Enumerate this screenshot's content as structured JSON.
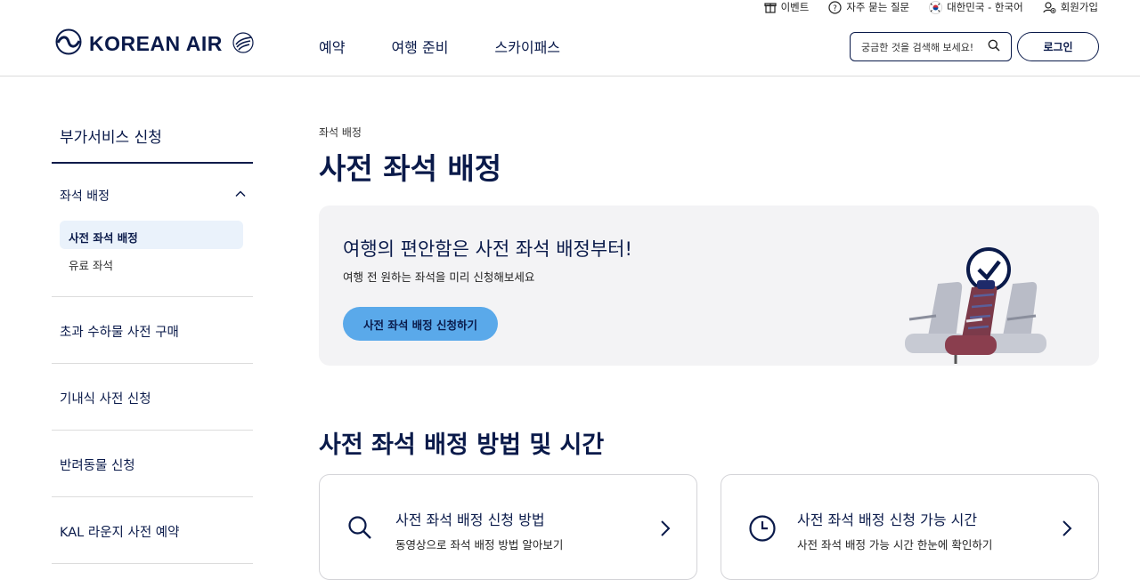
{
  "utility": {
    "items": [
      {
        "label": "이벤트",
        "icon": "gift-icon"
      },
      {
        "label": "자주 묻는 질문",
        "icon": "question-circle-icon"
      },
      {
        "label": "대한민국 - 한국어",
        "icon": "korea-flag-icon"
      },
      {
        "label": "회원가입",
        "icon": "user-add-icon"
      }
    ]
  },
  "header": {
    "logo_text": "KOREAN AIR",
    "nav": [
      "예약",
      "여행 준비",
      "스카이패스"
    ],
    "search_placeholder": "궁금한 것을 검색해 보세요!",
    "login_label": "로그인"
  },
  "sidebar": {
    "title": "부가서비스 신청",
    "group": {
      "label": "좌석 배정",
      "children": [
        "사전 좌석 배정",
        "유료 좌석"
      ]
    },
    "links": [
      "초과 수하물 사전 구매",
      "기내식 사전 신청",
      "반려동물 신청",
      "KAL 라운지 사전 예약"
    ]
  },
  "main": {
    "breadcrumb": "좌석 배정",
    "title": "사전 좌석 배정",
    "banner": {
      "headline": "여행의 편안함은 사전 좌석 배정부터!",
      "subtext": "여행 전 원하는 좌석을 미리 신청해보세요",
      "button_label": "사전 좌석 배정 신청하기"
    },
    "section_title": "사전 좌석 배정 방법 및 시간",
    "cards": [
      {
        "title": "사전 좌석 배정 신청 방법",
        "subtitle": "동영상으로 좌석 배정 방법 알아보기",
        "icon": "search-icon"
      },
      {
        "title": "사전 좌석 배정 신청 가능 시간",
        "subtitle": "사전 좌석 배정 가능 시간 한눈에 확인하기",
        "icon": "clock-icon"
      }
    ]
  },
  "colors": {
    "navy": "#0a1a4a",
    "accent_blue": "#5aa9ea",
    "banner_bg": "#f3f3f5",
    "active_bg": "#eaf2fb"
  }
}
